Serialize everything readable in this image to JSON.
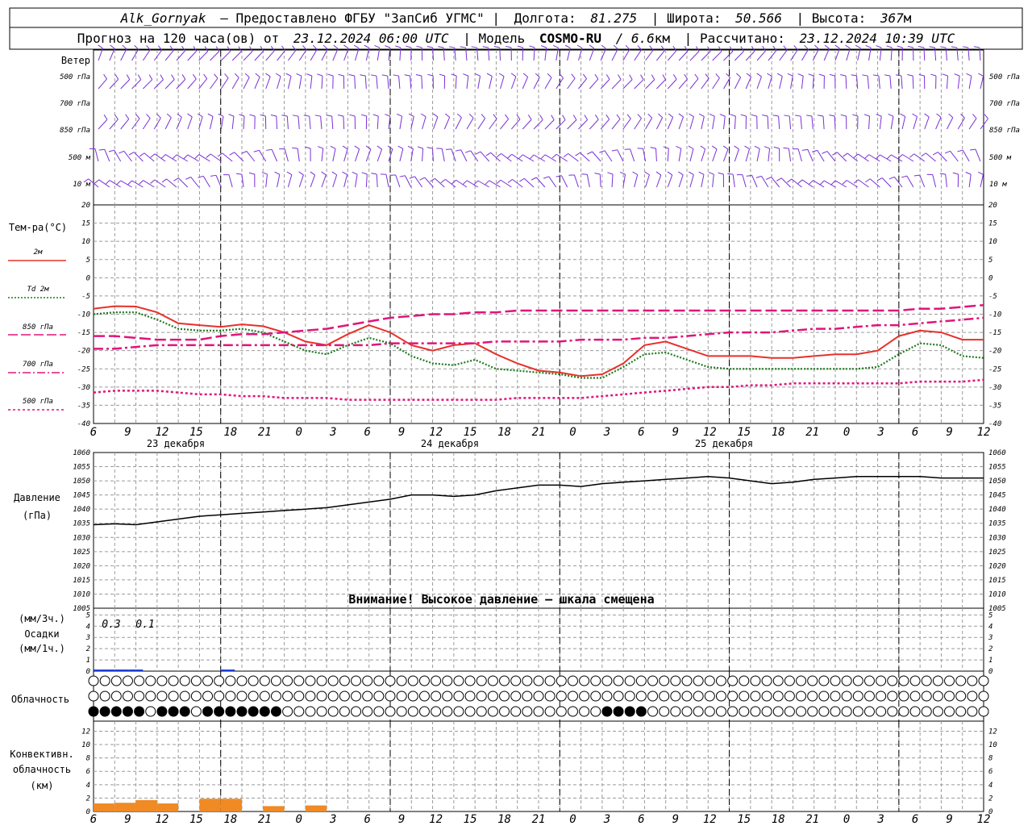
{
  "header": {
    "station": "Alk_Gornyak",
    "provider": "– Предоставлено ФГБУ \"ЗапСиб УГМС\" |",
    "lon_label": "Долгота:",
    "lon_value": "81.275",
    "lat_label": "| Широта:",
    "lat_value": "50.566",
    "alt_label": "| Высота:",
    "alt_value": "367",
    "alt_unit": "м",
    "forecast_label": "Прогноз на 120 часа(ов) от",
    "forecast_start": "23.12.2024 06:00 UTC",
    "model_label": "| Модель",
    "model_name": "COSMO-RU",
    "model_res": "/ 6.6",
    "model_res_unit": "км",
    "calc_label": "| Рассчитано:",
    "calc_time": "23.12.2024 10:39 UTC"
  },
  "wind_panel": {
    "title": "Ветер",
    "levels": [
      "500 гПа",
      "700 гПа",
      "850 гПа",
      "500 м",
      "10 м"
    ],
    "levels_right": [
      "500 гПа",
      "700 гПа",
      "850 гПа",
      "500 м",
      "10 м"
    ],
    "color": "#7a2fd6"
  },
  "temp_panel": {
    "title": "Тем-ра(°С)",
    "legend": [
      {
        "label": "2м",
        "color": "#e8302a",
        "style": "solid"
      },
      {
        "label": "Td  2м",
        "color": "#1e7a1e",
        "style": "dotted"
      },
      {
        "label": "850 гПа",
        "color": "#e0157a",
        "style": "long-dash"
      },
      {
        "label": "700 гПа",
        "color": "#e0157a",
        "style": "dash-dot"
      },
      {
        "label": "500 гПа",
        "color": "#e0157a",
        "style": "short-dash"
      }
    ],
    "yticks": [
      "20",
      "15",
      "10",
      "5",
      "0",
      "-5",
      "-10",
      "-15",
      "-20",
      "-25",
      "-30",
      "-35",
      "-40"
    ]
  },
  "x_axis": {
    "ticks": [
      "6",
      "9",
      "12",
      "15",
      "18",
      "21",
      "0",
      "3",
      "6",
      "9",
      "12",
      "15",
      "18",
      "21",
      "0",
      "3",
      "6",
      "9",
      "12",
      "15",
      "18",
      "21",
      "0",
      "3",
      "6",
      "9",
      "12"
    ],
    "dates": [
      "23 декабря",
      "24 декабря",
      "25 декабря"
    ]
  },
  "pressure_panel": {
    "title": "Давление",
    "unit": "(гПа)",
    "yticks": [
      "1060",
      "1055",
      "1050",
      "1045",
      "1040",
      "1035",
      "1030",
      "1025",
      "1020",
      "1015",
      "1010",
      "1005"
    ],
    "warning": "Внимание! Высокое давление – шкала смещена"
  },
  "precip_panel": {
    "unit3h": "(мм/3ч.)",
    "title": "Осадки",
    "unit1h": "(мм/1ч.)",
    "yticks": [
      "5",
      "4",
      "3",
      "2",
      "1",
      "0"
    ],
    "annotations": [
      "0.3",
      "0.1"
    ],
    "color": "#1f3fd0"
  },
  "cloud_panel": {
    "title": "Облачность"
  },
  "conv_panel": {
    "title_line1": "Конвективн.",
    "title_line2": "облачность",
    "unit": "(км)",
    "yticks": [
      "12",
      "10",
      "8",
      "6",
      "4",
      "2",
      "0"
    ],
    "color": "#f08a24"
  },
  "chart_data": [
    {
      "type": "line",
      "title": "Тем-ра(°С)",
      "x_hours": [
        0,
        3,
        6,
        9,
        12,
        15,
        18,
        21,
        24,
        27,
        30,
        33,
        36,
        39,
        42,
        45,
        48,
        51,
        54,
        57,
        60,
        63,
        66,
        69,
        72,
        75,
        78,
        81,
        84,
        87,
        90,
        93,
        96,
        99,
        102,
        105,
        108,
        111,
        114,
        117,
        120,
        123,
        126
      ],
      "x_tick_labels": [
        "6",
        "9",
        "12",
        "15",
        "18",
        "21",
        "0",
        "3",
        "6",
        "9",
        "12",
        "15",
        "18",
        "21",
        "0",
        "3",
        "6",
        "9",
        "12",
        "15",
        "18",
        "21",
        "0",
        "3",
        "6",
        "9",
        "12"
      ],
      "ylim": [
        -40,
        20
      ],
      "series": [
        {
          "name": "2м",
          "values": [
            -8.5,
            -7.8,
            -7.9,
            -9.5,
            -12.5,
            -13,
            -13.5,
            -12.8,
            -13.3,
            -15,
            -17.5,
            -18.5,
            -15.5,
            -13,
            -15,
            -18.5,
            -20,
            -18.5,
            -18,
            -21,
            -23.5,
            -25.5,
            -26,
            -27,
            -26.5,
            -23.5,
            -18.5,
            -17.5,
            -19.5,
            -21.5,
            -21.5,
            -21.5,
            -22,
            -22,
            -21.5,
            -21,
            -21,
            -20,
            -16,
            -14.5,
            -15,
            -17,
            -17
          ]
        },
        {
          "name": "Td  2м",
          "values": [
            -10,
            -9.5,
            -9.5,
            -11.5,
            -14,
            -14.5,
            -14.5,
            -14,
            -15,
            -17.5,
            -20,
            -21,
            -18.5,
            -16.5,
            -18,
            -21.5,
            -23.5,
            -24,
            -22.5,
            -25,
            -25.5,
            -26,
            -26.5,
            -27.5,
            -27.5,
            -24.5,
            -21,
            -20.5,
            -22.5,
            -24.5,
            -25,
            -25,
            -25,
            -25,
            -25,
            -25,
            -25,
            -24.5,
            -21,
            -18,
            -18.5,
            -21.5,
            -22
          ]
        },
        {
          "name": "850 гПа",
          "values": [
            -16,
            -16,
            -16.5,
            -17,
            -17,
            -17,
            -16,
            -15.5,
            -15.5,
            -15,
            -14.5,
            -14,
            -13,
            -12,
            -11,
            -10.5,
            -10,
            -10,
            -9.5,
            -9.5,
            -9,
            -9,
            -9,
            -9,
            -9,
            -9,
            -9,
            -9,
            -9,
            -9,
            -9,
            -9,
            -9,
            -9,
            -9,
            -9,
            -9,
            -9,
            -9,
            -8.5,
            -8.5,
            -8,
            -7.5
          ]
        },
        {
          "name": "700 гПа",
          "values": [
            -19.5,
            -19.5,
            -19,
            -18.5,
            -18.5,
            -18.5,
            -18.5,
            -18.5,
            -18.5,
            -18.5,
            -18.5,
            -18.5,
            -18.5,
            -18.5,
            -18,
            -18,
            -18,
            -18,
            -18,
            -17.5,
            -17.5,
            -17.5,
            -17.5,
            -17,
            -17,
            -17,
            -16.5,
            -16.5,
            -16,
            -15.5,
            -15,
            -15,
            -15,
            -14.5,
            -14,
            -14,
            -13.5,
            -13,
            -13,
            -12.5,
            -12,
            -11.5,
            -11
          ]
        },
        {
          "name": "500 гПа",
          "values": [
            -31.5,
            -31,
            -31,
            -31,
            -31.5,
            -32,
            -32,
            -32.5,
            -32.5,
            -33,
            -33,
            -33,
            -33.5,
            -33.5,
            -33.5,
            -33.5,
            -33.5,
            -33.5,
            -33.5,
            -33.5,
            -33,
            -33,
            -33,
            -33,
            -32.5,
            -32,
            -31.5,
            -31,
            -30.5,
            -30,
            -30,
            -29.5,
            -29.5,
            -29,
            -29,
            -29,
            -29,
            -29,
            -29,
            -28.5,
            -28.5,
            -28.5,
            -28
          ]
        }
      ]
    },
    {
      "type": "line",
      "title": "Давление",
      "ylabel": "(гПа)",
      "ylim": [
        1005,
        1060
      ],
      "x_hours": [
        0,
        3,
        6,
        9,
        12,
        15,
        18,
        21,
        24,
        27,
        30,
        33,
        36,
        39,
        42,
        45,
        48,
        51,
        54,
        57,
        60,
        63,
        66,
        69,
        72,
        75,
        78,
        81,
        84,
        87,
        90,
        93,
        96,
        99,
        102,
        105,
        108,
        111,
        114,
        117,
        120,
        123,
        126
      ],
      "series": [
        {
          "name": "Давление",
          "values": [
            1034.5,
            1034.8,
            1034.5,
            1035.5,
            1036.5,
            1037.5,
            1038,
            1038.5,
            1039,
            1039.5,
            1040,
            1040.5,
            1041.5,
            1042.5,
            1043.5,
            1045,
            1045,
            1044.5,
            1045,
            1046.5,
            1047.5,
            1048.5,
            1048.5,
            1048,
            1049,
            1049.5,
            1050,
            1050.5,
            1051,
            1051.5,
            1051,
            1050,
            1049,
            1049.5,
            1050.5,
            1051,
            1051.5,
            1051.5,
            1051.5,
            1051.5,
            1051,
            1051,
            1051
          ]
        }
      ]
    },
    {
      "type": "bar",
      "title": "Осадки",
      "ylabel": "(мм/1ч.)",
      "ylim": [
        0,
        5
      ],
      "x_hours": [
        0,
        1,
        2,
        3,
        4,
        5,
        6,
        7,
        8,
        9,
        10,
        11,
        12,
        13,
        14,
        15,
        16,
        17,
        18,
        19,
        20
      ],
      "values": [
        0.05,
        0.05,
        0.1,
        0.1,
        0.1,
        0.1,
        0.05,
        0,
        0,
        0,
        0,
        0,
        0,
        0,
        0,
        0,
        0,
        0,
        0.05,
        0.05,
        0
      ]
    },
    {
      "type": "bar",
      "title": "Конвективн. облачность",
      "ylabel": "(км)",
      "ylim": [
        0,
        13
      ],
      "x_hours": [
        0,
        3,
        6,
        9,
        12,
        15,
        18,
        21,
        24,
        27,
        30
      ],
      "values": [
        1.2,
        1.3,
        1.7,
        1.2,
        0,
        1.9,
        1.9,
        0,
        0.8,
        0,
        0.9
      ]
    }
  ]
}
